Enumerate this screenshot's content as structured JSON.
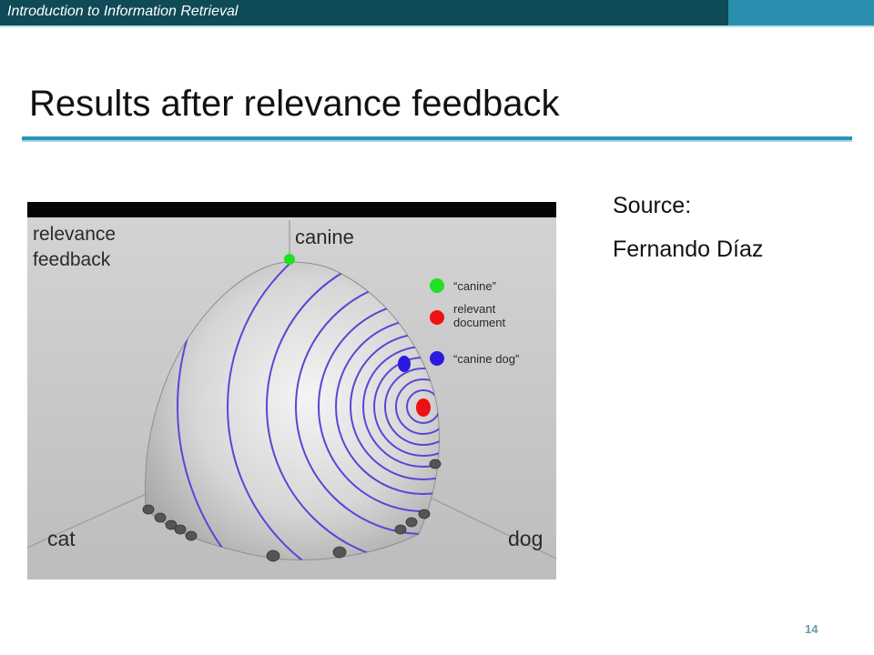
{
  "header": {
    "course_title": "Introduction to Information Retrieval",
    "bar_color": "#0f4a57",
    "accent_color": "#2b8fb0"
  },
  "slide": {
    "title": "Results after relevance feedback",
    "source_label": "Source:",
    "source_name": "Fernando Díaz",
    "page_number": "14"
  },
  "figure": {
    "corner_label_line1": "relevance",
    "corner_label_line2": "feedback",
    "axis_top": "canine",
    "axis_left": "cat",
    "axis_right": "dog",
    "legend": [
      {
        "label_line1": "“canine”",
        "label_line2": "",
        "color": "#22e022"
      },
      {
        "label_line1": "relevant",
        "label_line2": "document",
        "color": "#ee1111"
      },
      {
        "label_line1": "“canine dog”",
        "label_line2": "",
        "color": "#2a1ae0"
      }
    ],
    "contour_color": "#5b45d6"
  }
}
